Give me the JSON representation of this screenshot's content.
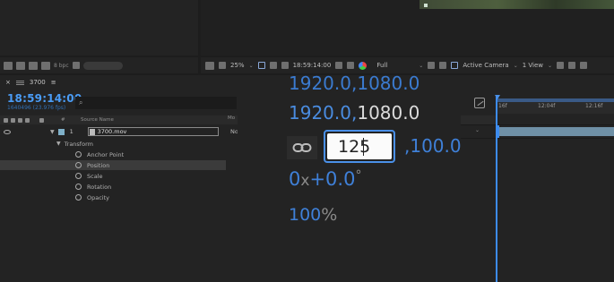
{
  "viewer": {
    "bpc_label": "8 bpc",
    "zoom": "25%",
    "timecode": "18:59:14:00",
    "resolution": "Full",
    "camera": "Active Camera",
    "views": "1 View"
  },
  "timeline": {
    "tab_label": "3700",
    "timecode": "18:59:14:00",
    "frame_info": "1640496 (23.976 fps)",
    "columns": {
      "num": "#",
      "source": "Source Name",
      "mode": "Mo"
    },
    "layer": {
      "index": "1",
      "name": "3700.mov",
      "mode": "No"
    },
    "transform_label": "Transform",
    "properties": [
      "Anchor Point",
      "Position",
      "Scale",
      "Rotation",
      "Opacity"
    ],
    "ruler_ticks": [
      "16f",
      "12:04f",
      "12:16f"
    ]
  },
  "zoom_overlay": {
    "ghost_dims": "1920.0,1080.0",
    "width_value": "1920.0",
    "comma": ",",
    "height_value": "1080.0",
    "scale_input": "125",
    "scale_y": ",100.0",
    "rotation_turns": "0",
    "rotation_x": "x",
    "rotation_deg": "+0.0",
    "rotation_unit": "°",
    "opacity_value": "100",
    "opacity_unit": "%"
  },
  "colors": {
    "accent_blue": "#3f8cf0",
    "panel_bg": "#232323",
    "layer_bar": "#6f90a6"
  }
}
